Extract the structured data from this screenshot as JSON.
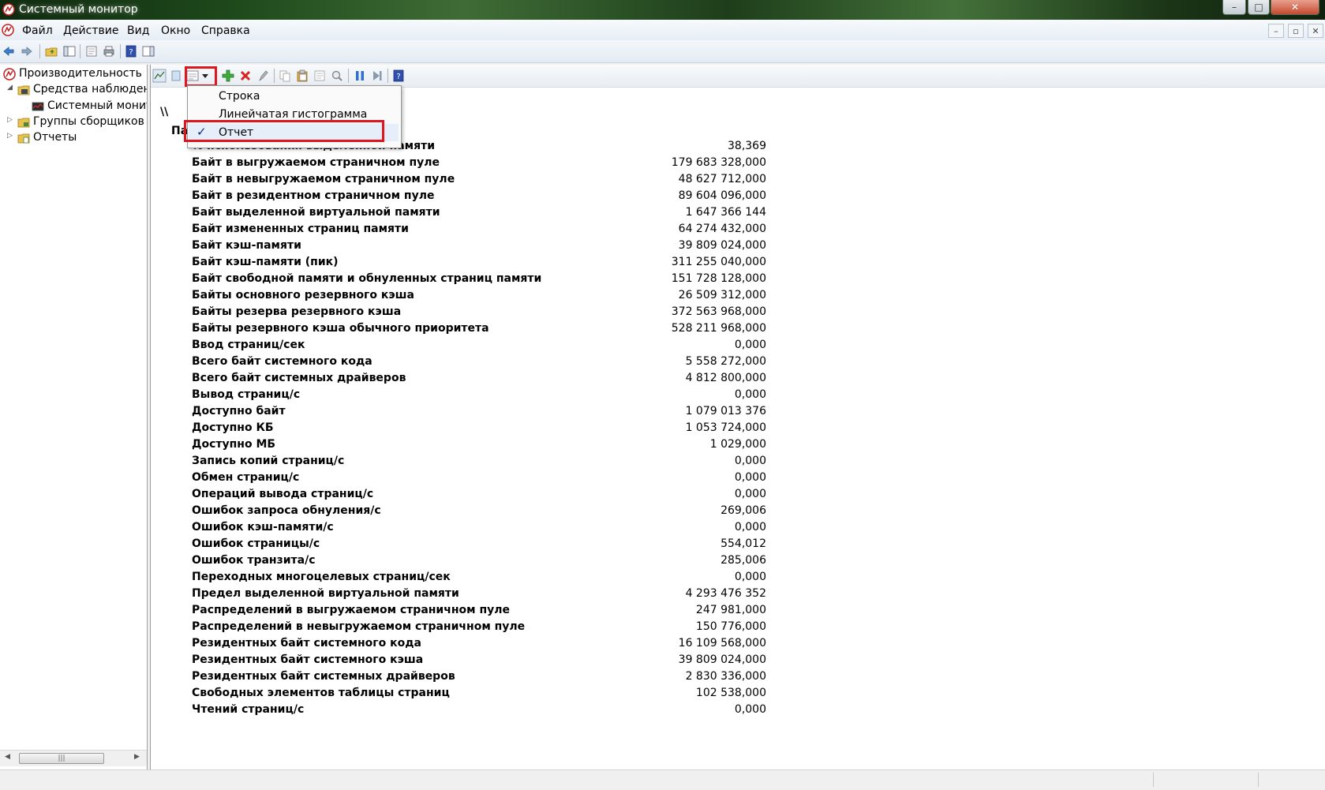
{
  "window": {
    "title": "Системный монитор",
    "buttons": {
      "minimize": "–",
      "maximize": "□",
      "close": "✕"
    }
  },
  "menu": {
    "items": [
      "Файл",
      "Действие",
      "Вид",
      "Окно",
      "Справка"
    ],
    "mdi_buttons": {
      "minimize": "–",
      "restore": "▫",
      "close": "✕"
    }
  },
  "tree": {
    "items": [
      {
        "label": "Производительность",
        "icon": "performance-icon"
      },
      {
        "label": "Средства наблюдения",
        "icon": "monitoring-tools-icon"
      },
      {
        "label": "Системный монитор",
        "icon": "system-monitor-icon"
      },
      {
        "label": "Группы сборщиков данных",
        "icon": "data-collector-icon"
      },
      {
        "label": "Отчеты",
        "icon": "reports-icon"
      }
    ],
    "scroll_thumb": "|||"
  },
  "view_menu": {
    "items": [
      {
        "label": "Строка",
        "checked": false
      },
      {
        "label": "Линейчатая гистограмма",
        "checked": false
      },
      {
        "label": "Отчет",
        "checked": true
      }
    ],
    "check_mark": "✓"
  },
  "report": {
    "computer": "\\\\",
    "object": "Па",
    "counters": [
      {
        "name": "% использования выделенной памяти",
        "value": "38,369"
      },
      {
        "name": "Байт в выгружаемом страничном пуле",
        "value": "179 683 328,000"
      },
      {
        "name": "Байт в невыгружаемом страничном пуле",
        "value": "48 627 712,000"
      },
      {
        "name": "Байт в резидентном страничном пуле",
        "value": "89 604 096,000"
      },
      {
        "name": "Байт выделенной виртуальной памяти",
        "value": "1 647 366 144"
      },
      {
        "name": "Байт измененных страниц памяти",
        "value": "64 274 432,000"
      },
      {
        "name": "Байт кэш-памяти",
        "value": "39 809 024,000"
      },
      {
        "name": "Байт кэш-памяти (пик)",
        "value": "311 255 040,000"
      },
      {
        "name": "Байт свободной памяти и обнуленных страниц памяти",
        "value": "151 728 128,000"
      },
      {
        "name": "Байты основного резервного кэша",
        "value": "26 509 312,000"
      },
      {
        "name": "Байты резерва резервного кэша",
        "value": "372 563 968,000"
      },
      {
        "name": "Байты резервного кэша обычного приоритета",
        "value": "528 211 968,000"
      },
      {
        "name": "Ввод страниц/сек",
        "value": "0,000"
      },
      {
        "name": "Всего байт системного кода",
        "value": "5 558 272,000"
      },
      {
        "name": "Всего байт системных драйверов",
        "value": "4 812 800,000"
      },
      {
        "name": "Вывод страниц/с",
        "value": "0,000"
      },
      {
        "name": "Доступно байт",
        "value": "1 079 013 376"
      },
      {
        "name": "Доступно КБ",
        "value": "1 053 724,000"
      },
      {
        "name": "Доступно МБ",
        "value": "1 029,000"
      },
      {
        "name": "Запись копий страниц/с",
        "value": "0,000"
      },
      {
        "name": "Обмен страниц/с",
        "value": "0,000"
      },
      {
        "name": "Операций вывода страниц/с",
        "value": "0,000"
      },
      {
        "name": "Ошибок запроса обнуления/с",
        "value": "269,006"
      },
      {
        "name": "Ошибок кэш-памяти/с",
        "value": "0,000"
      },
      {
        "name": "Ошибок страницы/с",
        "value": "554,012"
      },
      {
        "name": "Ошибок транзита/с",
        "value": "285,006"
      },
      {
        "name": "Переходных многоцелевых страниц/сек",
        "value": "0,000"
      },
      {
        "name": "Предел выделенной виртуальной памяти",
        "value": "4 293 476 352"
      },
      {
        "name": "Распределений в выгружаемом страничном пуле",
        "value": "247 981,000"
      },
      {
        "name": "Распределений в невыгружаемом страничном пуле",
        "value": "150 776,000"
      },
      {
        "name": "Резидентных байт системного кода",
        "value": "16 109 568,000"
      },
      {
        "name": "Резидентных байт системного кэша",
        "value": "39 809 024,000"
      },
      {
        "name": "Резидентных байт системных драйверов",
        "value": "2 830 336,000"
      },
      {
        "name": "Свободных элементов таблицы страниц",
        "value": "102 538,000"
      },
      {
        "name": "Чтений страниц/с",
        "value": "0,000"
      }
    ]
  },
  "colors": {
    "highlight": "#e0161f",
    "check": "#0b2a8f"
  }
}
